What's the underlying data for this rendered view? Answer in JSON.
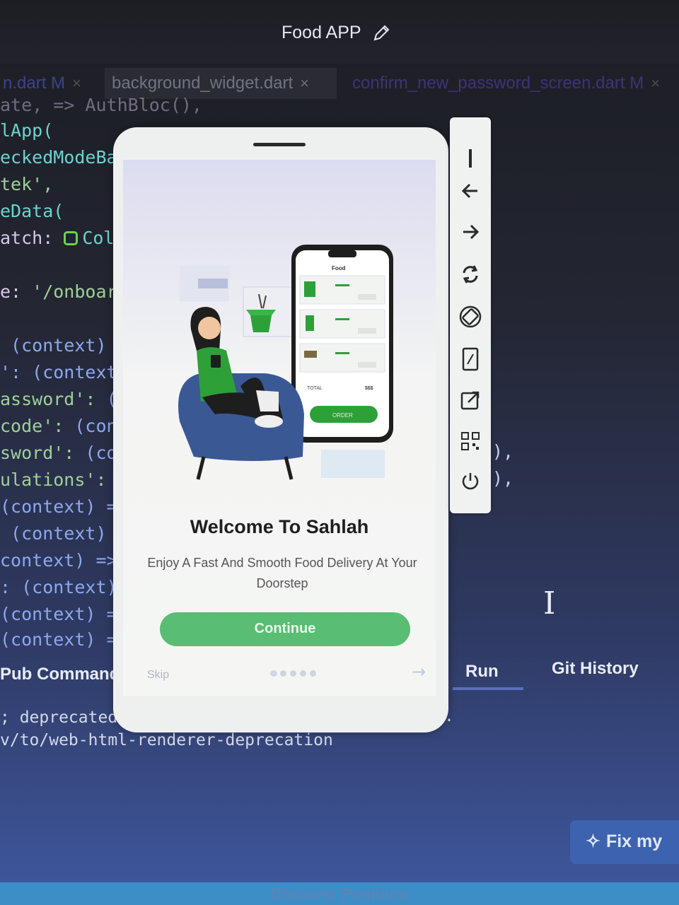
{
  "window": {
    "title": "Food APP"
  },
  "tabs": [
    {
      "label": "n.dart M",
      "close": "×"
    },
    {
      "label": "background_widget.dart",
      "close": "×"
    },
    {
      "label": "confirm_new_password_screen.dart M",
      "close": "×"
    }
  ],
  "code": {
    "l0": "ate, => AuthBloc(),",
    "l1": "lApp(",
    "l2": "eckedModeBa",
    "l3": "tek',",
    "l4": "eData(",
    "l5_key": "atch: ",
    "l5_val": "Col",
    "l6_key": "e: ",
    "l6_val": "'/onboar",
    "l7": " (context) =",
    "l8": "': (context",
    "l9_key": "assword': ",
    "l9_val": "(",
    "l10_key": "code': ",
    "l10_val": "(con",
    "l11_key": "sword': ",
    "l11_val": "(co",
    "l12": "ulations':",
    "l13": "(context) =",
    "l14": " (context) =",
    "l15": "context) =>",
    "l16": ": (context)",
    "l17": "(context) =",
    "l18": "(context) =",
    "r1": "),",
    "r2": "),"
  },
  "panel": {
    "pub_commands": "Pub Commands",
    "run": "Run",
    "git_history": "Git History",
    "output_1": "; deprecated. S",
    "output_1_tail": ".",
    "output_2": "v/to/web-html-renderer-deprecation"
  },
  "phone": {
    "title": "Welcome To Sahlah",
    "subtitle": "Enjoy A Fast And Smooth Food Delivery At Your Doorstep",
    "continue_label": "Continue",
    "skip_label": "Skip",
    "next_arrow": "→",
    "illustration": {
      "screen_title": "Food",
      "total_label": "TOTAL",
      "total_value": "$$$",
      "order_label": "ORDER"
    }
  },
  "toolbar": {
    "icons": [
      "drag-handle-icon",
      "back-arrow-icon",
      "forward-arrow-icon",
      "rotate-refresh-icon",
      "screen-rotate-icon",
      "device-frame-icon",
      "open-external-icon",
      "qr-code-icon",
      "power-icon"
    ]
  },
  "fix_button": {
    "label": "Fix my"
  },
  "premium": {
    "label": "Discover Premium"
  },
  "colors": {
    "accent_green": "#59bd73",
    "editor_bg": "#1f2027",
    "panel_blue": "#3d62b0"
  }
}
